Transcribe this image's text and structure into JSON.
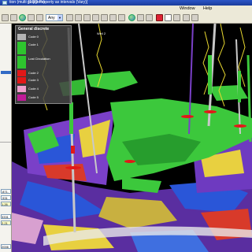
{
  "window": {
    "title": "tion (multi polygons)",
    "title_right": "[1:3D-Property as intervals (Vary)]"
  },
  "menu": {
    "items": [
      "Window",
      "Help"
    ]
  },
  "toolbar": {
    "view_combo": "Any"
  },
  "left_panel": {
    "fields": [
      ".871.",
      ".531",
      "1.26",
      "3331",
      "2.21",
      "2006"
    ]
  },
  "legend": {
    "title": "General discrete",
    "items": [
      {
        "label": "Code 0",
        "color": "#b4b4b4"
      },
      {
        "label": "Code 1",
        "color": "#2ec42e"
      },
      {
        "label": "Lost Circulation",
        "color": "#2ec42e"
      },
      {
        "label": "Code 2",
        "color": "#e21818"
      },
      {
        "label": "Code 3",
        "color": "#e21818"
      },
      {
        "label": "Code 4",
        "color": "#f0a0ce"
      },
      {
        "label": "Code 5",
        "color": "#c01a98"
      }
    ]
  },
  "scene": {
    "well_labels": [
      "Well 2"
    ],
    "colors": {
      "geobody": "#3cc83c",
      "geobody_dark": "#1e8a26",
      "well": "#c8c8c8",
      "trace": "#e8d830",
      "property_purple": "#7a40c8",
      "property_blue": "#2a56d8",
      "property_yellow": "#e8d040",
      "property_red": "#d83a2a"
    }
  }
}
